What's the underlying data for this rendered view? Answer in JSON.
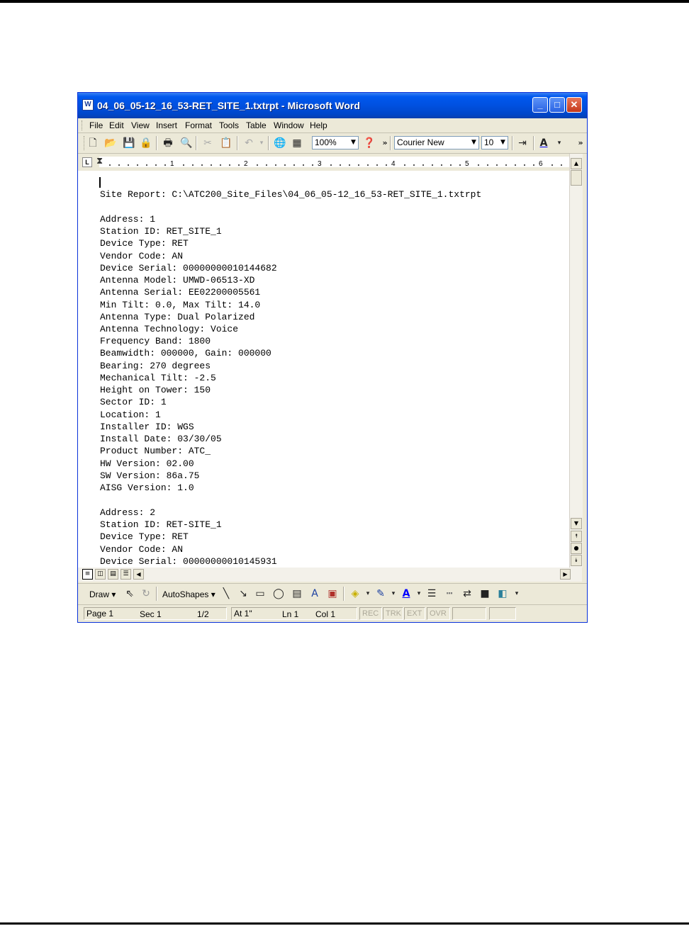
{
  "window": {
    "title": "04_06_05-12_16_53-RET_SITE_1.txtrpt - Microsoft Word",
    "icon": "word-document-icon",
    "controls": {
      "minimize": "_",
      "maximize": "□",
      "close": "✕"
    }
  },
  "menubar": [
    "File",
    "Edit",
    "View",
    "Insert",
    "Format",
    "Tools",
    "Table",
    "Window",
    "Help"
  ],
  "toolbar": {
    "zoom": "100%",
    "font": "Courier New",
    "font_size": "10",
    "overflow": "»",
    "icons": [
      "new-icon",
      "open-icon",
      "save-icon",
      "permission-icon",
      "print-icon",
      "print-preview-icon",
      "cut-icon",
      "paste-icon",
      "undo-icon",
      "web-icon",
      "table-icon",
      "help-icon",
      "indent-icon",
      "font-color-icon"
    ]
  },
  "ruler": {
    "tab_marker": "L",
    "numbers": [
      "1",
      "2",
      "3",
      "4",
      "5",
      "6"
    ]
  },
  "document": {
    "lines": [
      "Site Report: C:\\ATC200_Site_Files\\04_06_05-12_16_53-RET_SITE_1.txtrpt",
      "",
      "Address: 1",
      "Station ID: RET_SITE_1",
      "Device Type: RET",
      "Vendor Code: AN",
      "Device Serial: 00000000010144682",
      "Antenna Model: UMWD-06513-XD",
      "Antenna Serial: EE02200005561",
      "Min Tilt: 0.0, Max Tilt: 14.0",
      "Antenna Type: Dual Polarized",
      "Antenna Technology: Voice",
      "Frequency Band: 1800",
      "Beamwidth: 000000, Gain: 000000",
      "Bearing: 270 degrees",
      "Mechanical Tilt: -2.5",
      "Height on Tower: 150",
      "Sector ID: 1",
      "Location: 1",
      "Installer ID: WGS",
      "Install Date: 03/30/05",
      "Product Number: ATC_",
      "HW Version: 02.00",
      "SW Version: 86a.75",
      "AISG Version: 1.0",
      "",
      "Address: 2",
      "Station ID: RET-SITE_1",
      "Device Type: RET",
      "Vendor Code: AN",
      "Device Serial: 00000000010145931"
    ]
  },
  "drawing_toolbar": {
    "draw": "Draw ▾",
    "autoshapes": "AutoShapes ▾"
  },
  "statusbar": {
    "page": "Page 1",
    "section": "Sec 1",
    "page_of": "1/2",
    "at": "At 1\"",
    "line": "Ln 1",
    "column": "Col 1",
    "modes": [
      "REC",
      "TRK",
      "EXT",
      "OVR"
    ]
  }
}
